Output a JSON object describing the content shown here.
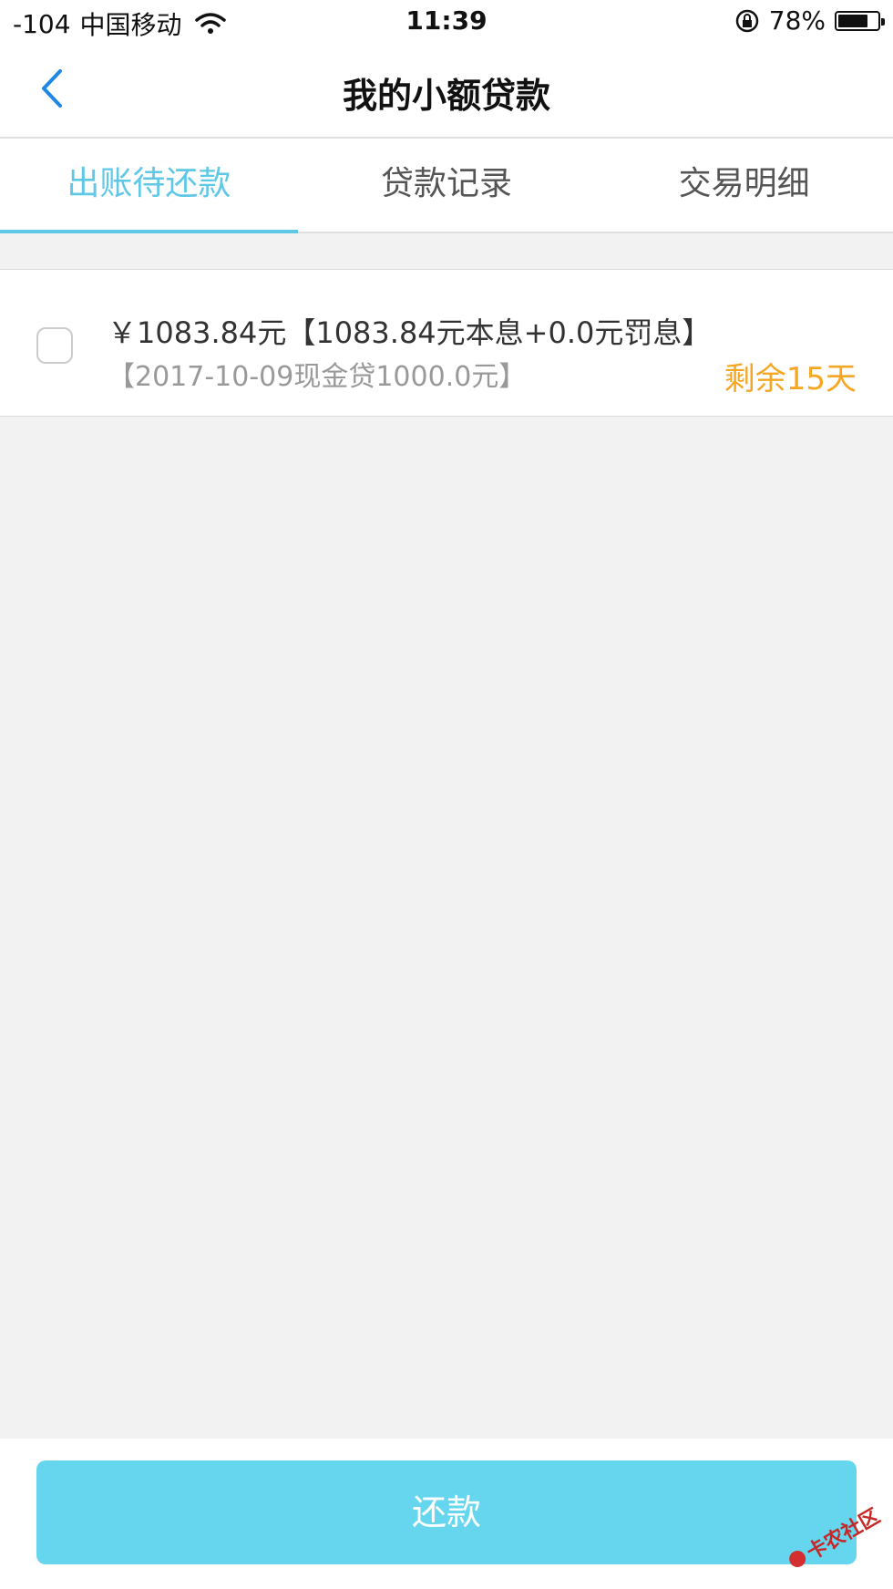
{
  "status_bar": {
    "signal": "-104",
    "carrier": "中国移动",
    "time": "11:39",
    "battery_percent": "78%",
    "battery_level": 0.78
  },
  "nav": {
    "title": "我的小额贷款"
  },
  "tabs": [
    {
      "label": "出账待还款",
      "active": true
    },
    {
      "label": "贷款记录",
      "active": false
    },
    {
      "label": "交易明细",
      "active": false
    }
  ],
  "bill": {
    "amount_line": "￥1083.84元【1083.84元本息+0.0元罚息】",
    "detail_line": "【2017-10-09现金贷1000.0元】",
    "remaining": "剩余15天"
  },
  "footer": {
    "pay_label": "还款"
  },
  "watermark": {
    "text": "卡农社区"
  },
  "colors": {
    "accent": "#5ec8e6",
    "button": "#66d6ef",
    "remaining": "#f5a623",
    "background": "#f2f2f2"
  }
}
